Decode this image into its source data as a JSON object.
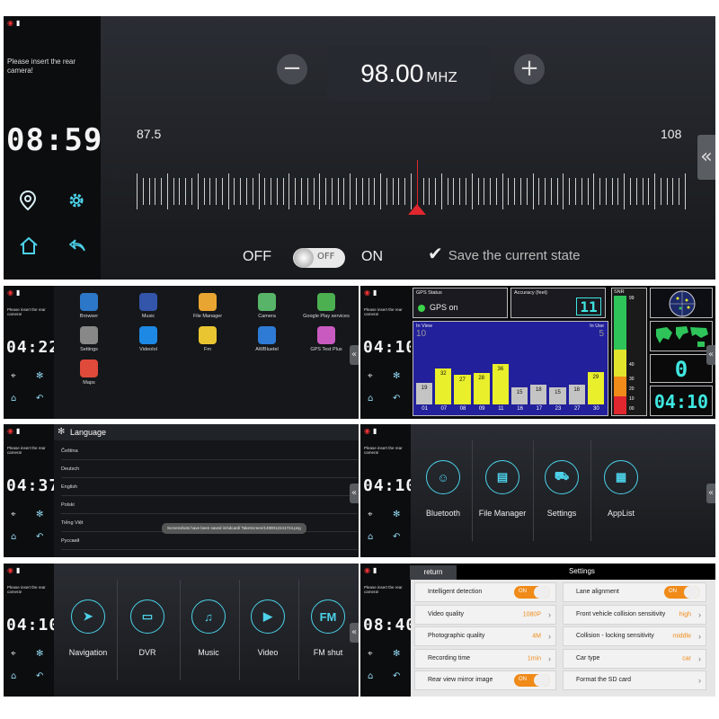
{
  "sidebar": {
    "rear_camera_message": "Please insert the rear camera!"
  },
  "fm": {
    "frequency": "98.00",
    "unit": "MHZ",
    "scale_min": "87.5",
    "scale_max": "108",
    "minus": "−",
    "plus": "+",
    "off_label": "OFF",
    "on_label": "ON",
    "toggle_state": "OFF",
    "save_label": "Save the current state",
    "clock": "08:59",
    "needle_value": 98.0
  },
  "apps": {
    "clock": "04:22",
    "items": [
      {
        "label": "Browser",
        "color": "#2d77c8"
      },
      {
        "label": "Music",
        "color": "#3355aa"
      },
      {
        "label": "File Manager",
        "color": "#e9a531"
      },
      {
        "label": "Camera",
        "color": "#58b468"
      },
      {
        "label": "Google Play services",
        "color": "#4caf50"
      },
      {
        "label": "Settings",
        "color": "#888888"
      },
      {
        "label": "VideoIol",
        "color": "#1e88e5"
      },
      {
        "label": "Fm",
        "color": "#e9c531"
      },
      {
        "label": "AWBluetel",
        "color": "#2e7bd6"
      },
      {
        "label": "GPS Test Plus",
        "color": "#c95bc0"
      },
      {
        "label": "Maps",
        "color": "#e04a3a"
      }
    ]
  },
  "gps": {
    "clock": "04:10",
    "status_title": "GPS Status",
    "status_value": "GPS on",
    "accuracy_title": "Accuracy (feet)",
    "accuracy_value": "11",
    "in_view_label": "In View",
    "in_view_value": "10",
    "in_use_label": "In Use",
    "in_use_value": "5",
    "snr_label": "SNR",
    "snr_ticks": [
      "99",
      "40",
      "30",
      "20",
      "10",
      "00"
    ],
    "sat_count": "0",
    "time": "04:10",
    "bars": [
      {
        "prn": "01",
        "snr": 19,
        "used": false
      },
      {
        "prn": "07",
        "snr": 32,
        "used": true
      },
      {
        "prn": "08",
        "snr": 27,
        "used": true
      },
      {
        "prn": "09",
        "snr": 28,
        "used": true
      },
      {
        "prn": "11",
        "snr": 36,
        "used": true
      },
      {
        "prn": "16",
        "snr": 15,
        "used": false
      },
      {
        "prn": "17",
        "snr": 18,
        "used": false
      },
      {
        "prn": "23",
        "snr": 15,
        "used": false
      },
      {
        "prn": "27",
        "snr": 18,
        "used": false
      },
      {
        "prn": "30",
        "snr": 29,
        "used": true
      }
    ]
  },
  "language": {
    "clock": "04:37",
    "title": "Language",
    "items": [
      "Čeština",
      "Deutsch",
      "English",
      "Polski",
      "Tiếng Việt",
      "Русский"
    ],
    "toast": "Screenshots have been saved in/sdcard/ TakeScreen/1490012241724.png"
  },
  "menu1": {
    "clock": "04:10",
    "items": [
      "Bluetooth",
      "File Manager",
      "Settings",
      "AppList"
    ]
  },
  "menu2": {
    "clock": "04:10",
    "items": [
      "Navigation",
      "DVR",
      "Music",
      "Video",
      "FM shut"
    ],
    "fm_icon_text": "FM"
  },
  "settings": {
    "clock": "08:40",
    "return_label": "return",
    "title": "Settings",
    "left_rows": [
      {
        "label": "Intelligent detection",
        "toggle": "ON"
      },
      {
        "label": "Video quality",
        "value": "1080P"
      },
      {
        "label": "Photographic quality",
        "value": "4M"
      },
      {
        "label": "Recording time",
        "value": "1min"
      },
      {
        "label": "Rear view mirror image",
        "toggle": "ON"
      }
    ],
    "right_rows": [
      {
        "label": "Lane alignment",
        "toggle": "ON"
      },
      {
        "label": "Front vehicle collision sensitivity",
        "value": "high"
      },
      {
        "label": "Collision - locking sensitivity",
        "value": "middle"
      },
      {
        "label": "Car type",
        "value": "car"
      },
      {
        "label": "Format the SD card"
      }
    ]
  },
  "collapse_glyph": "«"
}
